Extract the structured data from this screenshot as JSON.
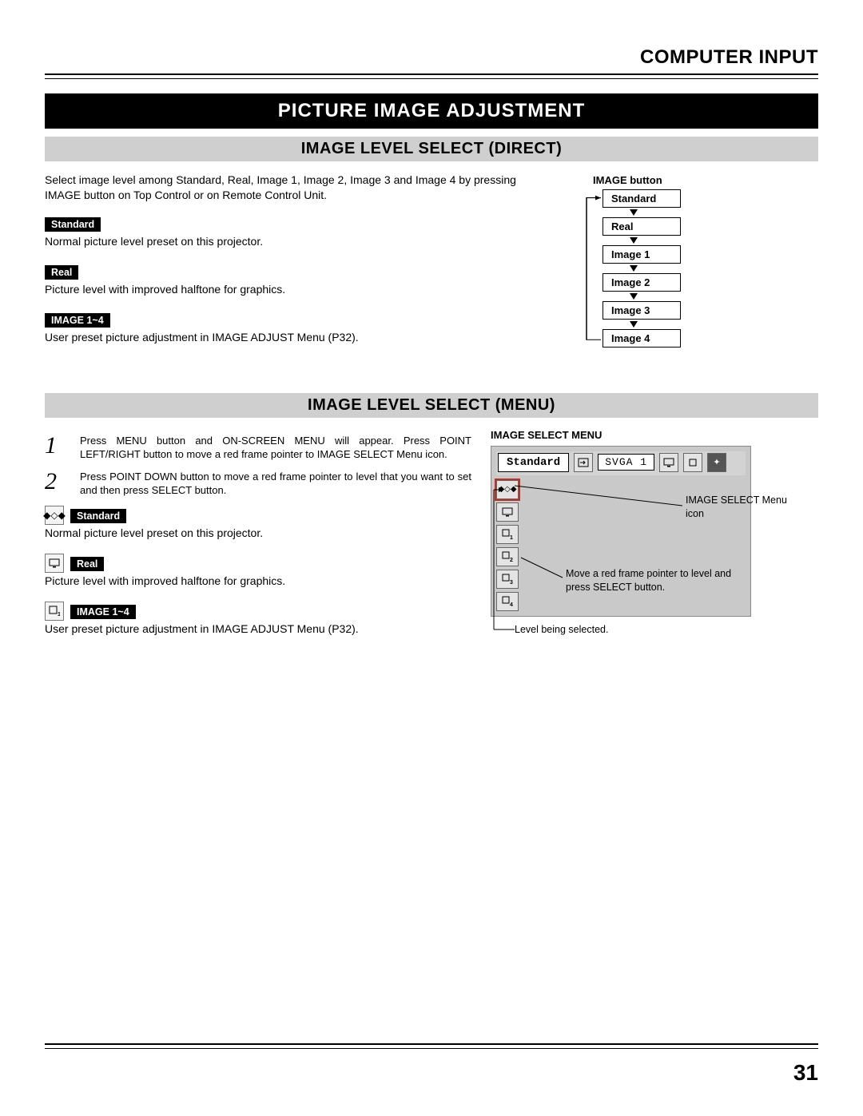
{
  "header": {
    "section": "COMPUTER INPUT"
  },
  "title": "PICTURE IMAGE ADJUSTMENT",
  "direct": {
    "heading": "IMAGE LEVEL SELECT (DIRECT)",
    "intro": "Select image level among Standard, Real, Image 1, Image 2, Image 3 and Image 4 by pressing IMAGE button on Top Control or on Remote Control Unit.",
    "items": {
      "standard": {
        "label": "Standard",
        "desc": "Normal picture level preset on this projector."
      },
      "real": {
        "label": "Real",
        "desc": "Picture level with improved halftone for graphics."
      },
      "image14": {
        "label": "IMAGE 1~4",
        "desc": "User preset picture adjustment in IMAGE ADJUST Menu (P32)."
      }
    },
    "flow": {
      "caption": "IMAGE button",
      "boxes": [
        "Standard",
        "Real",
        "Image 1",
        "Image 2",
        "Image 3",
        "Image 4"
      ]
    }
  },
  "menu": {
    "heading": "IMAGE LEVEL SELECT (MENU)",
    "steps": [
      "Press MENU button and ON-SCREEN MENU will appear.  Press POINT LEFT/RIGHT button to move a red frame pointer to IMAGE SELECT Menu icon.",
      "Press POINT DOWN button to move a red frame pointer to level that you want to set and then press SELECT button."
    ],
    "items": {
      "standard": {
        "label": "Standard",
        "desc": "Normal picture level preset on this projector."
      },
      "real": {
        "label": "Real",
        "desc": "Picture level with improved halftone for graphics."
      },
      "image14": {
        "label": "IMAGE 1~4",
        "desc": "User preset picture adjustment in IMAGE ADJUST Menu (P32)."
      }
    },
    "figure": {
      "title": "IMAGE SELECT MENU",
      "state": "Standard",
      "mode": "SVGA 1",
      "annot_icon": "IMAGE SELECT Menu icon",
      "annot_move": "Move a red frame pointer to level and press SELECT button.",
      "annot_sel": "Level being selected."
    }
  },
  "pagenum": "31"
}
